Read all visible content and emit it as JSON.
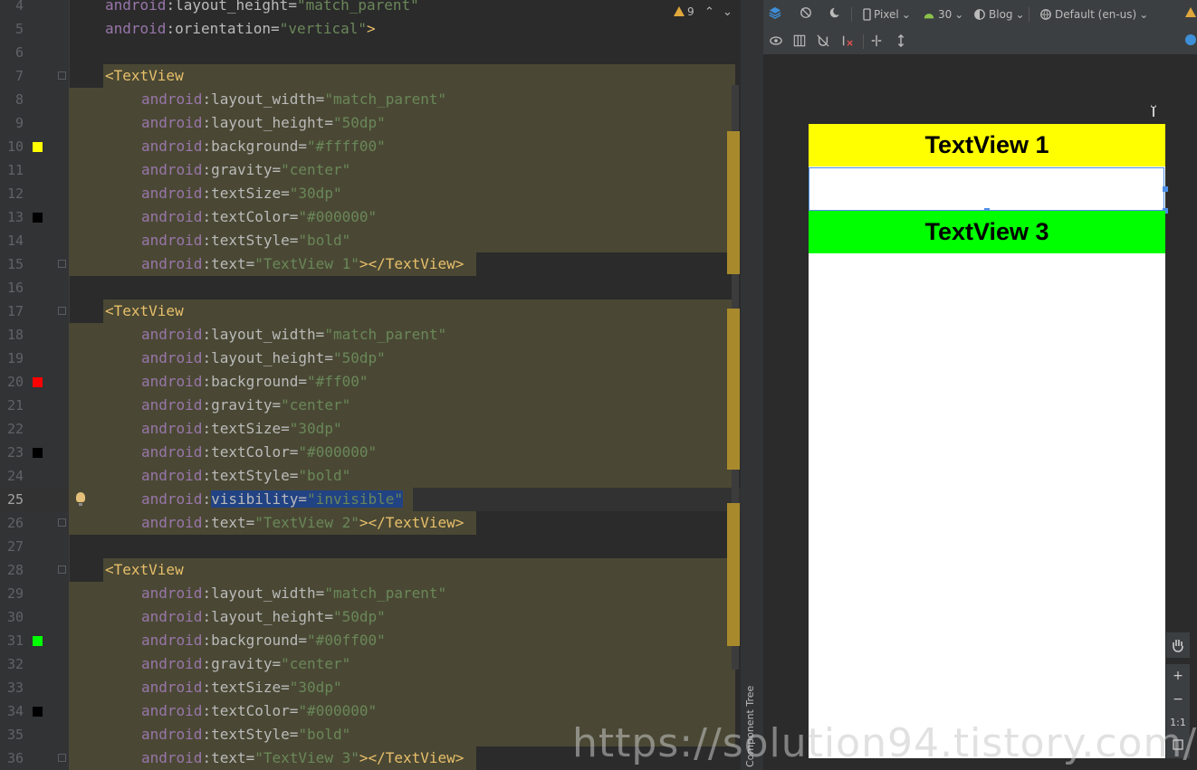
{
  "editor": {
    "warning_count": "9",
    "lines": [
      {
        "n": "4",
        "segs": [
          [
            "ns",
            "android"
          ],
          [
            "eq",
            ":"
          ],
          [
            "attr",
            "layout_height"
          ],
          [
            "eq",
            "="
          ],
          [
            "val",
            "\"match_parent\""
          ]
        ],
        "indent": 116,
        "band": false
      },
      {
        "n": "5",
        "segs": [
          [
            "ns",
            "android"
          ],
          [
            "eq",
            ":"
          ],
          [
            "attr",
            "orientation"
          ],
          [
            "eq",
            "="
          ],
          [
            "val",
            "\"vertical\""
          ],
          [
            "tag",
            ">"
          ]
        ],
        "indent": 116,
        "band": false
      },
      {
        "n": "6",
        "segs": [],
        "indent": 116,
        "band": false
      },
      {
        "n": "7",
        "segs": [
          [
            "tag",
            "<TextView"
          ]
        ],
        "indent": 116,
        "band": true,
        "fold": true
      },
      {
        "n": "8",
        "segs": [
          [
            "ns",
            "android"
          ],
          [
            "eq",
            ":"
          ],
          [
            "attr",
            "layout_width"
          ],
          [
            "eq",
            "="
          ],
          [
            "val",
            "\"match_parent\""
          ]
        ],
        "indent": 156,
        "band": true
      },
      {
        "n": "9",
        "segs": [
          [
            "ns",
            "android"
          ],
          [
            "eq",
            ":"
          ],
          [
            "attr",
            "layout_height"
          ],
          [
            "eq",
            "="
          ],
          [
            "val",
            "\"50dp\""
          ]
        ],
        "indent": 156,
        "band": true
      },
      {
        "n": "10",
        "segs": [
          [
            "ns",
            "android"
          ],
          [
            "eq",
            ":"
          ],
          [
            "attr",
            "background"
          ],
          [
            "eq",
            "="
          ],
          [
            "val",
            "\"#ffff00\""
          ]
        ],
        "indent": 156,
        "band": true,
        "swatch": "#ffff00"
      },
      {
        "n": "11",
        "segs": [
          [
            "ns",
            "android"
          ],
          [
            "eq",
            ":"
          ],
          [
            "attr",
            "gravity"
          ],
          [
            "eq",
            "="
          ],
          [
            "val",
            "\"center\""
          ]
        ],
        "indent": 156,
        "band": true
      },
      {
        "n": "12",
        "segs": [
          [
            "ns",
            "android"
          ],
          [
            "eq",
            ":"
          ],
          [
            "attr",
            "textSize"
          ],
          [
            "eq",
            "="
          ],
          [
            "val",
            "\"30dp\""
          ]
        ],
        "indent": 156,
        "band": true
      },
      {
        "n": "13",
        "segs": [
          [
            "ns",
            "android"
          ],
          [
            "eq",
            ":"
          ],
          [
            "attr",
            "textColor"
          ],
          [
            "eq",
            "="
          ],
          [
            "val",
            "\"#000000\""
          ]
        ],
        "indent": 156,
        "band": true,
        "swatch": "#000000"
      },
      {
        "n": "14",
        "segs": [
          [
            "ns",
            "android"
          ],
          [
            "eq",
            ":"
          ],
          [
            "attr",
            "textStyle"
          ],
          [
            "eq",
            "="
          ],
          [
            "val",
            "\"bold\""
          ]
        ],
        "indent": 156,
        "band": true
      },
      {
        "n": "15",
        "segs": [
          [
            "ns",
            "android"
          ],
          [
            "eq",
            ":"
          ],
          [
            "attr",
            "text"
          ],
          [
            "eq",
            "="
          ],
          [
            "val",
            "\"TextView 1\""
          ],
          [
            "tag",
            "></TextView>"
          ]
        ],
        "indent": 156,
        "band": true,
        "fold": true,
        "bandend": 526
      },
      {
        "n": "16",
        "segs": [],
        "indent": 116,
        "band": false
      },
      {
        "n": "17",
        "segs": [
          [
            "tag",
            "<TextView"
          ]
        ],
        "indent": 116,
        "band": true,
        "fold": true
      },
      {
        "n": "18",
        "segs": [
          [
            "ns",
            "android"
          ],
          [
            "eq",
            ":"
          ],
          [
            "attr",
            "layout_width"
          ],
          [
            "eq",
            "="
          ],
          [
            "val",
            "\"match_parent\""
          ]
        ],
        "indent": 156,
        "band": true
      },
      {
        "n": "19",
        "segs": [
          [
            "ns",
            "android"
          ],
          [
            "eq",
            ":"
          ],
          [
            "attr",
            "layout_height"
          ],
          [
            "eq",
            "="
          ],
          [
            "val",
            "\"50dp\""
          ]
        ],
        "indent": 156,
        "band": true
      },
      {
        "n": "20",
        "segs": [
          [
            "ns",
            "android"
          ],
          [
            "eq",
            ":"
          ],
          [
            "attr",
            "background"
          ],
          [
            "eq",
            "="
          ],
          [
            "val",
            "\"#ff00\""
          ]
        ],
        "indent": 156,
        "band": true,
        "swatch": "#ff0000"
      },
      {
        "n": "21",
        "segs": [
          [
            "ns",
            "android"
          ],
          [
            "eq",
            ":"
          ],
          [
            "attr",
            "gravity"
          ],
          [
            "eq",
            "="
          ],
          [
            "val",
            "\"center\""
          ]
        ],
        "indent": 156,
        "band": true
      },
      {
        "n": "22",
        "segs": [
          [
            "ns",
            "android"
          ],
          [
            "eq",
            ":"
          ],
          [
            "attr",
            "textSize"
          ],
          [
            "eq",
            "="
          ],
          [
            "val",
            "\"30dp\""
          ]
        ],
        "indent": 156,
        "band": true
      },
      {
        "n": "23",
        "segs": [
          [
            "ns",
            "android"
          ],
          [
            "eq",
            ":"
          ],
          [
            "attr",
            "textColor"
          ],
          [
            "eq",
            "="
          ],
          [
            "val",
            "\"#000000\""
          ]
        ],
        "indent": 156,
        "band": true,
        "swatch": "#000000"
      },
      {
        "n": "24",
        "segs": [
          [
            "ns",
            "android"
          ],
          [
            "eq",
            ":"
          ],
          [
            "attr",
            "textStyle"
          ],
          [
            "eq",
            "="
          ],
          [
            "val",
            "\"bold\""
          ]
        ],
        "indent": 156,
        "band": true
      },
      {
        "n": "25",
        "segs": [
          [
            "ns",
            "android"
          ],
          [
            "eq",
            ":"
          ],
          [
            "selattr",
            "visibility"
          ],
          [
            "seleq",
            "="
          ],
          [
            "selval",
            "\"invisible\""
          ]
        ],
        "indent": 156,
        "band": true,
        "bulb": true,
        "current": true,
        "bandend": 456
      },
      {
        "n": "26",
        "segs": [
          [
            "ns",
            "android"
          ],
          [
            "eq",
            ":"
          ],
          [
            "attr",
            "text"
          ],
          [
            "eq",
            "="
          ],
          [
            "val",
            "\"TextView 2\""
          ],
          [
            "tag",
            "></TextView>"
          ]
        ],
        "indent": 156,
        "band": true,
        "fold": true,
        "bandend": 526
      },
      {
        "n": "27",
        "segs": [],
        "indent": 116,
        "band": false
      },
      {
        "n": "28",
        "segs": [
          [
            "tag",
            "<TextView"
          ]
        ],
        "indent": 116,
        "band": true,
        "fold": true
      },
      {
        "n": "29",
        "segs": [
          [
            "ns",
            "android"
          ],
          [
            "eq",
            ":"
          ],
          [
            "attr",
            "layout_width"
          ],
          [
            "eq",
            "="
          ],
          [
            "val",
            "\"match_parent\""
          ]
        ],
        "indent": 156,
        "band": true
      },
      {
        "n": "30",
        "segs": [
          [
            "ns",
            "android"
          ],
          [
            "eq",
            ":"
          ],
          [
            "attr",
            "layout_height"
          ],
          [
            "eq",
            "="
          ],
          [
            "val",
            "\"50dp\""
          ]
        ],
        "indent": 156,
        "band": true
      },
      {
        "n": "31",
        "segs": [
          [
            "ns",
            "android"
          ],
          [
            "eq",
            ":"
          ],
          [
            "attr",
            "background"
          ],
          [
            "eq",
            "="
          ],
          [
            "val",
            "\"#00ff00\""
          ]
        ],
        "indent": 156,
        "band": true,
        "swatch": "#00ff00"
      },
      {
        "n": "32",
        "segs": [
          [
            "ns",
            "android"
          ],
          [
            "eq",
            ":"
          ],
          [
            "attr",
            "gravity"
          ],
          [
            "eq",
            "="
          ],
          [
            "val",
            "\"center\""
          ]
        ],
        "indent": 156,
        "band": true
      },
      {
        "n": "33",
        "segs": [
          [
            "ns",
            "android"
          ],
          [
            "eq",
            ":"
          ],
          [
            "attr",
            "textSize"
          ],
          [
            "eq",
            "="
          ],
          [
            "val",
            "\"30dp\""
          ]
        ],
        "indent": 156,
        "band": true
      },
      {
        "n": "34",
        "segs": [
          [
            "ns",
            "android"
          ],
          [
            "eq",
            ":"
          ],
          [
            "attr",
            "textColor"
          ],
          [
            "eq",
            "="
          ],
          [
            "val",
            "\"#000000\""
          ]
        ],
        "indent": 156,
        "band": true,
        "swatch": "#000000"
      },
      {
        "n": "35",
        "segs": [
          [
            "ns",
            "android"
          ],
          [
            "eq",
            ":"
          ],
          [
            "attr",
            "textStyle"
          ],
          [
            "eq",
            "="
          ],
          [
            "val",
            "\"bold\""
          ]
        ],
        "indent": 156,
        "band": true
      },
      {
        "n": "36",
        "segs": [
          [
            "ns",
            "android"
          ],
          [
            "eq",
            ":"
          ],
          [
            "attr",
            "text"
          ],
          [
            "eq",
            "="
          ],
          [
            "val",
            "\"TextView 3\""
          ],
          [
            "tag",
            "></TextView>"
          ]
        ],
        "indent": 156,
        "band": true,
        "fold": true,
        "bandend": 526
      }
    ]
  },
  "toolbar": {
    "device": "Pixel",
    "api": "30",
    "theme": "Blog",
    "locale": "Default (en-us)"
  },
  "preview": {
    "tv1": "TextView 1",
    "tv3": "TextView 3",
    "colors": {
      "tv1": "#ffff00",
      "tv3": "#00ff00"
    }
  },
  "zoom": {
    "plus": "+",
    "minus": "−",
    "one": "1:1"
  },
  "component_tree": "Component Tree",
  "watermark": "https://solution94.tistory.com/"
}
